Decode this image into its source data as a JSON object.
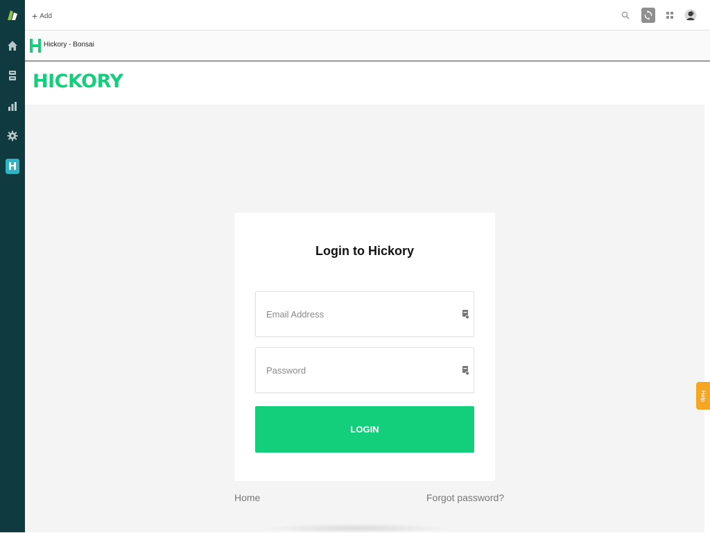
{
  "sidebar": {
    "items": [
      {
        "icon": "logo-icon"
      },
      {
        "icon": "home-icon"
      },
      {
        "icon": "apps-icon"
      },
      {
        "icon": "chart-icon"
      },
      {
        "icon": "gear-icon"
      },
      {
        "icon": "hickory-app-icon",
        "label": "H",
        "active": true
      }
    ]
  },
  "topbar": {
    "add_label": "Add",
    "icons": [
      "search-icon",
      "sync-icon",
      "grid-icon",
      "avatar"
    ]
  },
  "app_header": {
    "logo_letter": "H",
    "title": "Hickory - Bonsai"
  },
  "brand": {
    "name": "HICKORY"
  },
  "login": {
    "title": "Login to Hickory",
    "email_placeholder": "Email Address",
    "password_placeholder": "Password",
    "button_label": "LOGIN"
  },
  "links": {
    "home": "Home",
    "forgot": "Forgot password?"
  },
  "help": {
    "label": "Help"
  },
  "colors": {
    "sidebar_bg": "#0e3a40",
    "brand_green": "#13cf7b",
    "active_app": "#2fb4c4",
    "help_orange": "#f5a623"
  }
}
